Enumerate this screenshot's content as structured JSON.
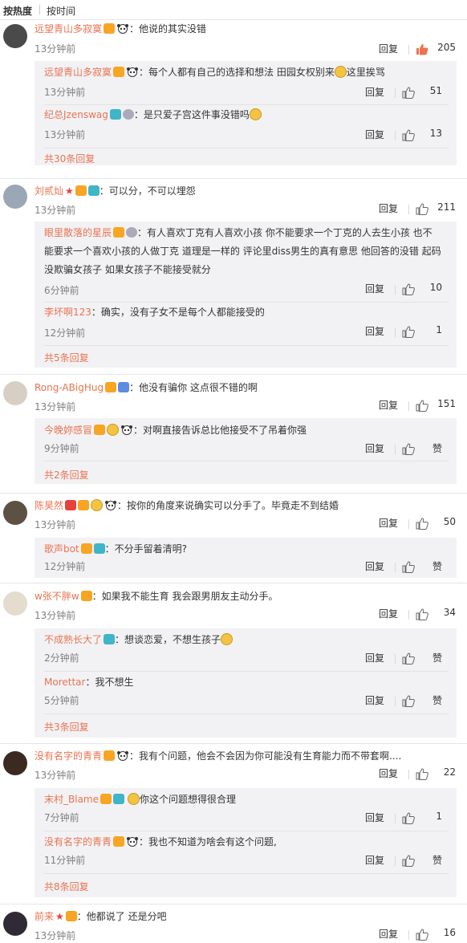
{
  "sort": {
    "hot": "按热度",
    "time": "按时间"
  },
  "reply_label": "回复",
  "comments": [
    {
      "user": "远望青山多寂寞",
      "text": "：他说的其实没错",
      "time": "13分钟前",
      "likes": "205",
      "liked": true,
      "replies": [
        {
          "user": "远望青山多寂寞",
          "text": "：每个人都有自己的选择和想法 田园女权别来",
          "text2": "这里挨骂",
          "time": "13分钟前",
          "likes": "51"
        },
        {
          "user": "纪总Jzenswag",
          "text": "：是只爱子宫这件事没错吗",
          "time": "13分钟前",
          "likes": "13"
        }
      ],
      "more": "共30条回复"
    },
    {
      "user": "刘贰灿",
      "text": "：可以分，不可以埋怨",
      "time": "13分钟前",
      "likes": "211",
      "replies": [
        {
          "user": "眼里散落的星辰",
          "text_lines": [
            "：有人喜欢丁克有人喜欢小孩 你不能要求一个丁克的人去生小孩 也不",
            "能要求一个喜欢小孩的人做丁克 道理是一样的 评论里diss男生的真有意思 他回答的没错 起码",
            "没欺骗女孩子 如果女孩子不能接受就分"
          ],
          "time": "6分钟前",
          "likes": "10"
        },
        {
          "user": "李坏啊123",
          "text": "：确实，没有子女不是每个人都能接受的",
          "time": "12分钟前",
          "likes": "1"
        }
      ],
      "more": "共5条回复"
    },
    {
      "user": "Rong-ABigHug",
      "text": "：他没有骗你 这点很不错的啊",
      "time": "13分钟前",
      "likes": "151",
      "replies": [
        {
          "user": "今晚妳感冒",
          "text": "：对啊直接告诉总比他接受不了吊着你强",
          "time": "9分钟前",
          "likes": "赞"
        }
      ],
      "more": "共2条回复"
    },
    {
      "user": "陈昊然",
      "text": "：按你的角度来说确实可以分手了。毕竟走不到结婚",
      "time": "13分钟前",
      "likes": "50",
      "replies": [
        {
          "user": "歌声bot",
          "text": "：不分手留着清明?",
          "time": "12分钟前",
          "likes": "赞"
        }
      ],
      "more": ""
    },
    {
      "user": "w张不胖w",
      "text": "：如果我不能生育 我会跟男朋友主动分手。",
      "time": "13分钟前",
      "likes": "34",
      "replies": [
        {
          "user": "不成熟长大了",
          "text": "：想谈恋爱，不想生孩子",
          "time": "2分钟前",
          "likes": "赞"
        },
        {
          "user": "Morettar",
          "text": "：我不想生",
          "time": "5分钟前",
          "likes": "赞"
        }
      ],
      "more": "共3条回复"
    },
    {
      "user": "没有名字的青青",
      "text": "：我有个问题，他会不会因为你可能没有生育能力而不带套啊....",
      "time": "13分钟前",
      "likes": "22",
      "replies": [
        {
          "user": "末村_Blame",
          "text": "你这个问题想得很合理",
          "time": "7分钟前",
          "likes": "1"
        },
        {
          "user": "没有名字的青青",
          "text": "：我也不知道为啥会有这个问题,",
          "time": "11分钟前",
          "likes": "赞"
        }
      ],
      "more": "共8条回复"
    },
    {
      "user": "前来",
      "text": "：他都说了 还是分吧",
      "time": "13分钟前",
      "likes": "16",
      "replies": [],
      "more": ""
    }
  ],
  "colors": {
    "username": "#eb7350",
    "time": "#808080",
    "sub_bg": "#f2f2f5",
    "liked": "#eb7350"
  }
}
